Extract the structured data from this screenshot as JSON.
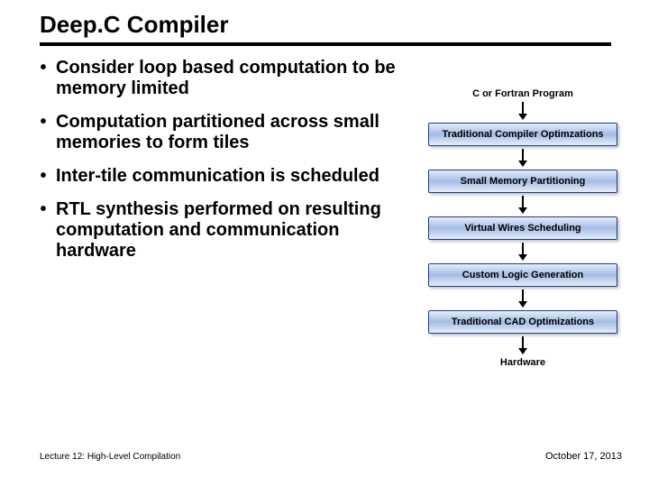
{
  "title": "Deep.C Compiler",
  "bullets": [
    "Consider loop based computation to be memory limited",
    "Computation partitioned across small memories to form tiles",
    "Inter-tile communication is scheduled",
    "RTL synthesis performed on resulting computation and communication hardware"
  ],
  "diagram": {
    "input_label": "C or Fortran Program",
    "stages": [
      "Traditional Compiler Optimzations",
      "Small Memory Partitioning",
      "Virtual Wires Scheduling",
      "Custom Logic Generation",
      "Traditional CAD Optimizations"
    ],
    "output_label": "Hardware"
  },
  "footer": {
    "left": "Lecture 12: High-Level Compilation",
    "right": "October 17, 2013"
  }
}
